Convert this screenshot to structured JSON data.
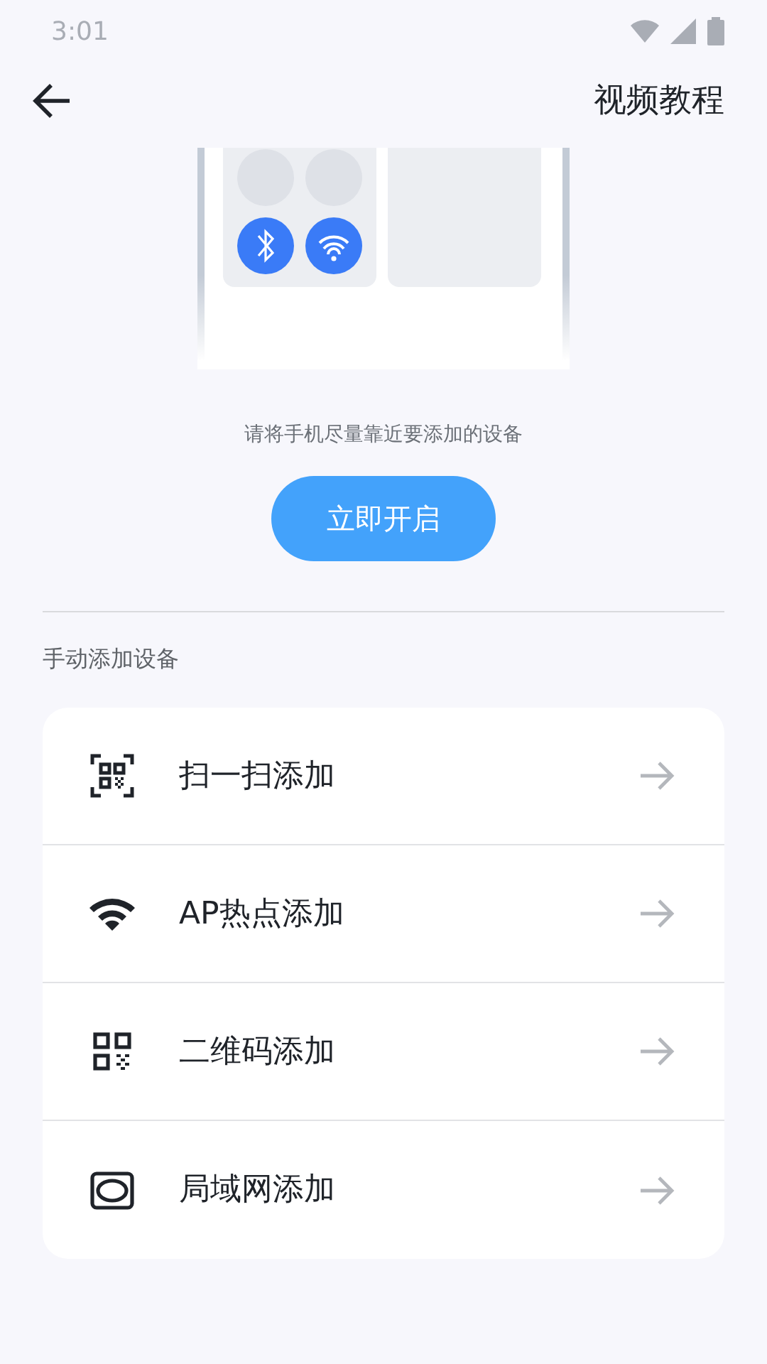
{
  "status_bar": {
    "time": "3:01"
  },
  "header": {
    "title": "视频教程"
  },
  "hint": "请将手机尽量靠近要添加的设备",
  "primary_button": "立即开启",
  "section_title": "手动添加设备",
  "items": [
    {
      "kind": "scan",
      "label": "扫一扫添加"
    },
    {
      "kind": "wifi",
      "label": "AP热点添加"
    },
    {
      "kind": "qr",
      "label": "二维码添加"
    },
    {
      "kind": "lan",
      "label": "局域网添加"
    }
  ]
}
